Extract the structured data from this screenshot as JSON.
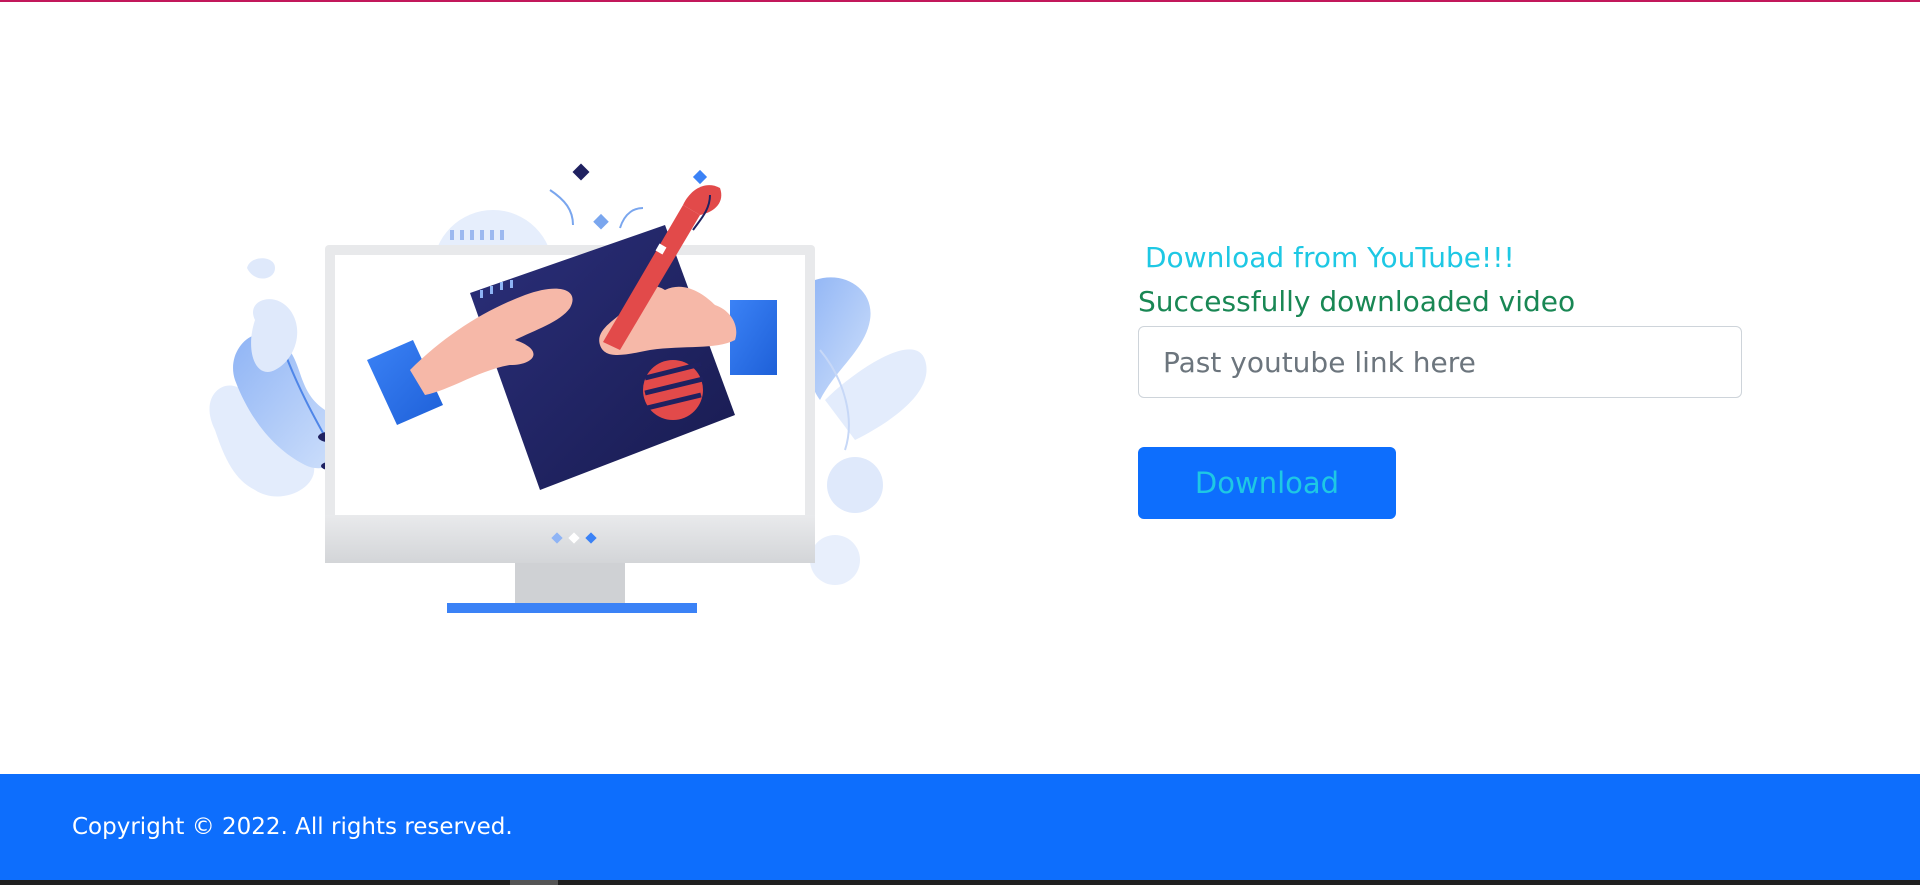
{
  "main": {
    "heading": "Download from YouTube!!!",
    "status_message": "Successfully downloaded video",
    "url_input": {
      "placeholder": "Past youtube link here",
      "value": ""
    },
    "download_button_label": "Download"
  },
  "footer": {
    "copyright": "Copyright © 2022. All rights reserved."
  },
  "colors": {
    "accent": "#0d6efd",
    "heading": "#1ec8e4",
    "success": "#198754",
    "top_border": "#c2185b"
  },
  "illustration": {
    "subject": "computer-monitor-drawing-illustration"
  }
}
